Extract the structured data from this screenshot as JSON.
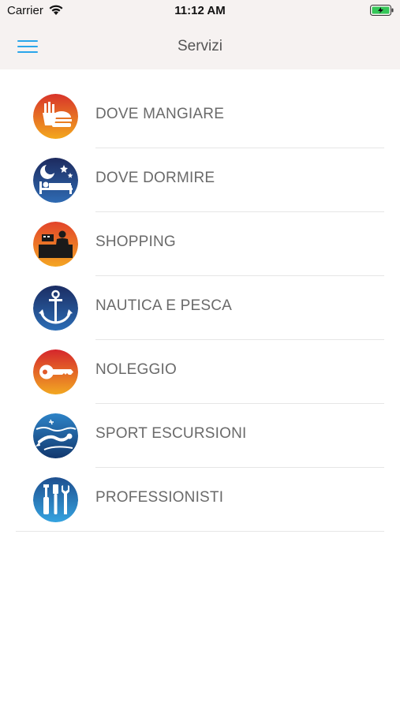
{
  "status_bar": {
    "carrier": "Carrier",
    "time": "11:12 AM",
    "battery_color": "#35c759"
  },
  "nav": {
    "title": "Servizi",
    "menu_icon": "hamburger-icon",
    "accent": "#2aa6ea"
  },
  "services": [
    {
      "label": "DOVE MANGIARE",
      "icon": "food-icon"
    },
    {
      "label": "DOVE DORMIRE",
      "icon": "sleep-icon"
    },
    {
      "label": "SHOPPING",
      "icon": "shop-icon"
    },
    {
      "label": "NAUTICA E PESCA",
      "icon": "anchor-icon"
    },
    {
      "label": "NOLEGGIO",
      "icon": "key-icon"
    },
    {
      "label": "SPORT ESCURSIONI",
      "icon": "diving-icon"
    },
    {
      "label": "PROFESSIONISTI",
      "icon": "tools-icon"
    }
  ]
}
